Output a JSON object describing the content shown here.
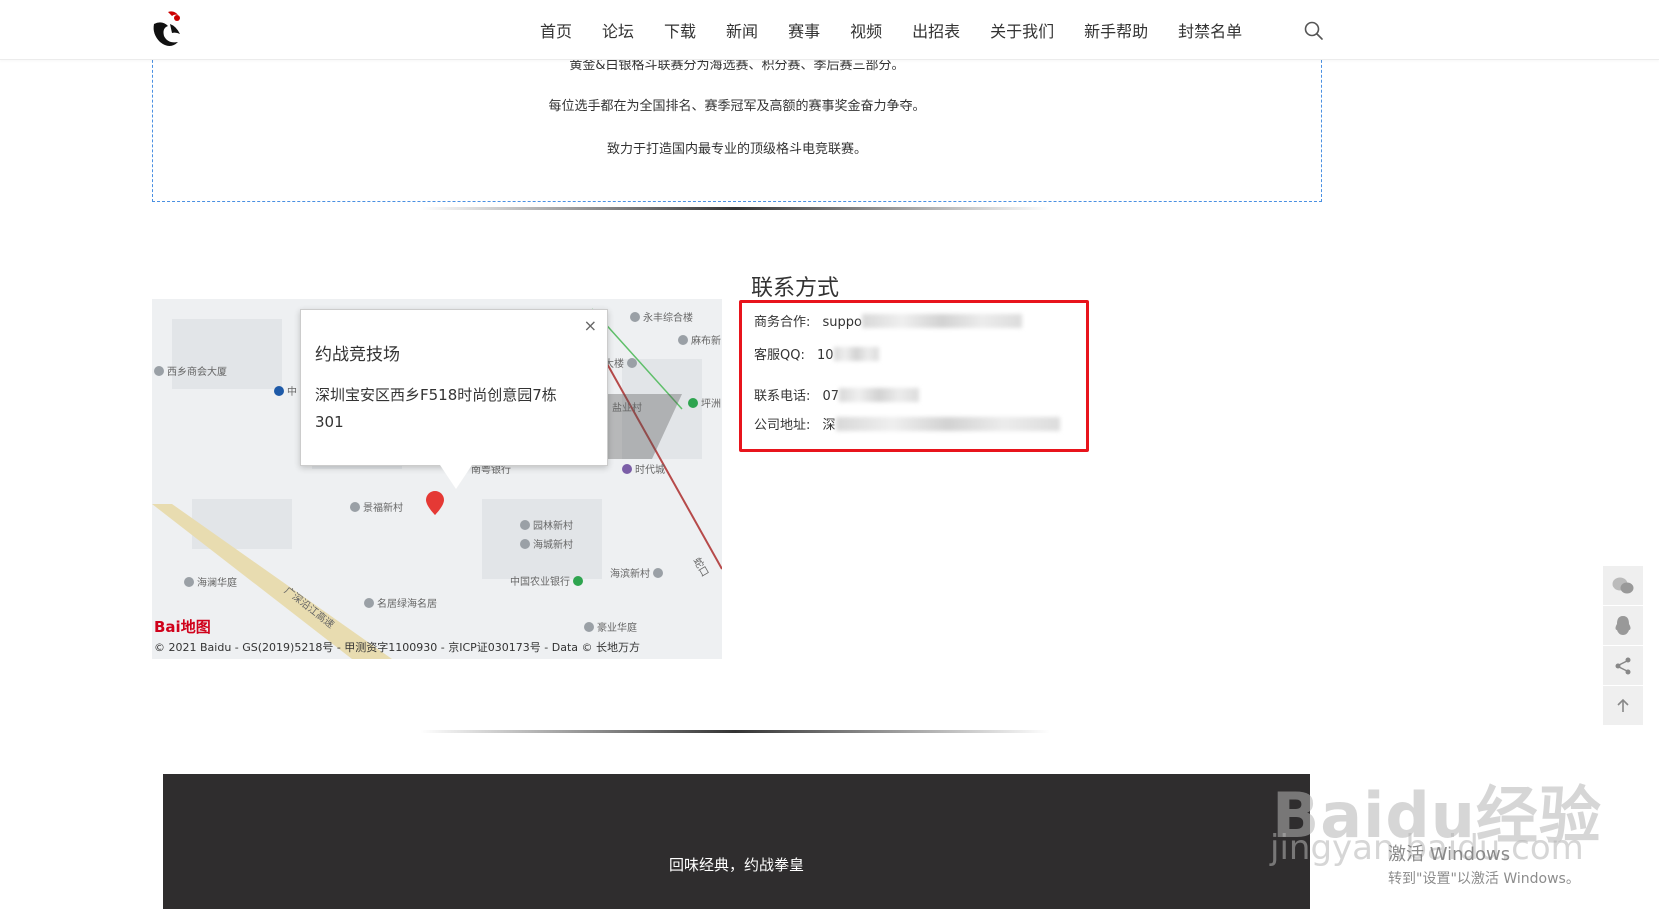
{
  "nav": {
    "items": [
      "首页",
      "论坛",
      "下载",
      "新闻",
      "赛事",
      "视频",
      "出招表",
      "关于我们",
      "新手帮助",
      "封禁名单"
    ]
  },
  "intro": {
    "line1": "黄金&白银格斗联赛分为海选赛、积分赛、季后赛三部分。",
    "line2": "每位选手都在为全国排名、赛季冠军及高额的赛事奖金奋力争夺。",
    "line3": "致力于打造国内最专业的顶级格斗电竞联赛。"
  },
  "map": {
    "popup_title": "约战竞技场",
    "popup_address": "深圳宝安区西乡F518时尚创意园7栋301",
    "close_symbol": "×",
    "logo_text": "Bai地图",
    "copyright": "© 2021 Baidu - GS(2019)5218号 - 甲测资字1100930 - 京ICP证030173号 - Data © 长地万方",
    "labels": [
      "永丰综合楼",
      "麻布新",
      "西乡商会大厦",
      "中",
      "大楼",
      "盐业村",
      "坪洲",
      "时代城",
      "南粤银行",
      "景福新村",
      "园林新村",
      "海城新村",
      "海滨新村",
      "中国农业银行",
      "海澜华庭",
      "名居绿海名居",
      "豪业华庭",
      "广深沿江高速",
      "蛇口"
    ]
  },
  "contact": {
    "title": "联系方式",
    "business_label": "商务合作:",
    "business_value": "suppo",
    "qq_label": "客服QQ:",
    "qq_value": "10",
    "phone_label": "联系电话:",
    "phone_value": "07",
    "address_label": "公司地址:",
    "address_value": "深"
  },
  "footer": {
    "slogan": "回味经典，约战拳皇"
  },
  "watermark": {
    "brand": "Baidu经验",
    "url": "jingyan.baidu.com",
    "activate_title": "激活 Windows",
    "activate_sub": "转到\"设置\"以激活 Windows。"
  },
  "colors": {
    "accent_red": "#e8141c",
    "dashed_border": "#4a90e2",
    "footer_bg": "#2f2d2e"
  }
}
